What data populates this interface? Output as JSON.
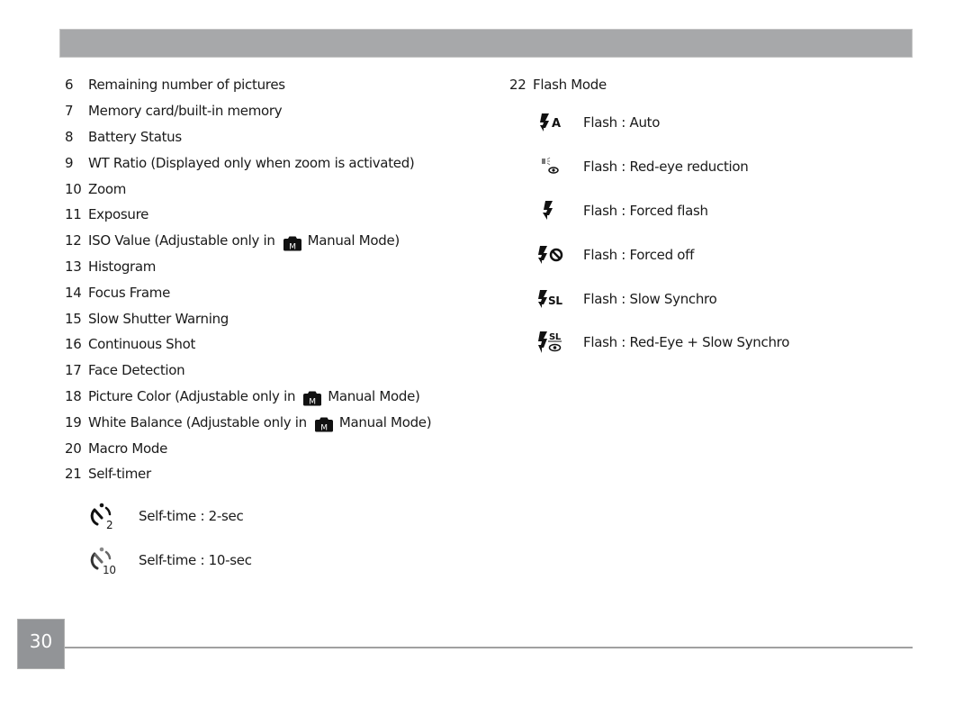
{
  "left_list": [
    {
      "num": "6",
      "text": "Remaining number of pictures"
    },
    {
      "num": "7",
      "text": "Memory card/built-in memory"
    },
    {
      "num": "8",
      "text": "Battery Status"
    },
    {
      "num": "9",
      "text": "WT Ratio (Displayed only when zoom is activated)"
    },
    {
      "num": "10",
      "text": "Zoom"
    },
    {
      "num": "11",
      "text": "Exposure"
    },
    {
      "num": "12",
      "text": "ISO Value (Adjustable only in",
      "suffix": "Manual Mode)",
      "icon": "manual-mode-camera-icon"
    },
    {
      "num": "13",
      "text": "Histogram"
    },
    {
      "num": "14",
      "text": "Focus Frame"
    },
    {
      "num": "15",
      "text": "Slow Shutter Warning"
    },
    {
      "num": "16",
      "text": "Continuous Shot"
    },
    {
      "num": "17",
      "text": "Face Detection"
    },
    {
      "num": "18",
      "text": "Picture Color (Adjustable only in",
      "suffix": "Manual Mode)",
      "icon": "manual-mode-camera-icon"
    },
    {
      "num": "19",
      "text": "White Balance (Adjustable only in",
      "suffix": "Manual Mode)",
      "icon": "manual-mode-camera-icon"
    },
    {
      "num": "20",
      "text": "Macro Mode"
    },
    {
      "num": "21",
      "text": "Self-timer"
    }
  ],
  "manual_icon_letter": "M",
  "self_timer_options": [
    {
      "icon": "self-timer-2sec-icon",
      "icon_label": "2",
      "text": "Self-time : 2-sec"
    },
    {
      "icon": "self-timer-10sec-icon",
      "icon_label": "10",
      "text": "Self-time : 10-sec"
    }
  ],
  "flash_heading": {
    "num": "22",
    "text": "Flash Mode"
  },
  "flash_options": [
    {
      "icon": "flash-auto-icon",
      "icon_label": "A",
      "text": "Flash : Auto"
    },
    {
      "icon": "flash-red-eye-icon",
      "icon_label": "",
      "text": "Flash : Red-eye reduction"
    },
    {
      "icon": "flash-forced-icon",
      "icon_label": "",
      "text": "Flash : Forced flash"
    },
    {
      "icon": "flash-off-icon",
      "icon_label": "",
      "text": "Flash : Forced off"
    },
    {
      "icon": "flash-slow-synchro-icon",
      "icon_label": "SL",
      "text": "Flash : Slow Synchro"
    },
    {
      "icon": "flash-red-eye-slow-synchro-icon",
      "icon_label": "SL",
      "text": "Flash : Red-Eye + Slow Synchro"
    }
  ],
  "page_number": "30",
  "colors": {
    "header_bar": "#a7a8aa",
    "page_box": "#929497",
    "footer_line": "#a0a0a0",
    "text": "#1a1a1a"
  }
}
